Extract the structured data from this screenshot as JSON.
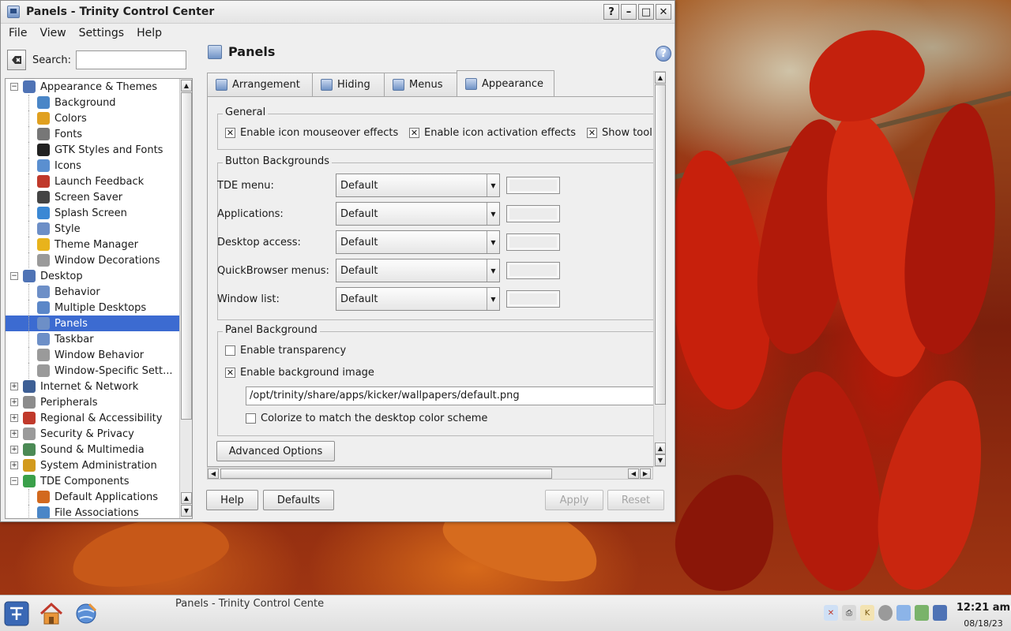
{
  "window": {
    "title": "Panels - Trinity Control Center",
    "buttons": {
      "help": "?",
      "minimize": "–",
      "maximize": "□",
      "close": "✕"
    }
  },
  "menubar": [
    "File",
    "View",
    "Settings",
    "Help"
  ],
  "search": {
    "label": "Search:",
    "value": "",
    "placeholder": ""
  },
  "tree": [
    {
      "label": "Appearance & Themes",
      "type": "parent",
      "expanded": true,
      "icon": "appearance-icon",
      "color": "#4f73b5"
    },
    {
      "label": "Background",
      "type": "child",
      "icon": "background-icon",
      "color": "#4a86c7"
    },
    {
      "label": "Colors",
      "type": "child",
      "icon": "colors-icon",
      "color": "#e0a020"
    },
    {
      "label": "Fonts",
      "type": "child",
      "icon": "fonts-icon",
      "color": "#777777"
    },
    {
      "label": "GTK Styles and Fonts",
      "type": "child",
      "icon": "gtk-icon",
      "color": "#222222"
    },
    {
      "label": "Icons",
      "type": "child",
      "icon": "icons-icon",
      "color": "#5a8fd0"
    },
    {
      "label": "Launch Feedback",
      "type": "child",
      "icon": "launch-feedback-icon",
      "color": "#c0392b"
    },
    {
      "label": "Screen Saver",
      "type": "child",
      "icon": "screensaver-icon",
      "color": "#444444"
    },
    {
      "label": "Splash Screen",
      "type": "child",
      "icon": "splash-icon",
      "color": "#3b88d4"
    },
    {
      "label": "Style",
      "type": "child",
      "icon": "style-icon",
      "color": "#6d8fc7"
    },
    {
      "label": "Theme Manager",
      "type": "child",
      "icon": "theme-manager-icon",
      "color": "#e8b31c"
    },
    {
      "label": "Window Decorations",
      "type": "child",
      "icon": "window-decorations-icon",
      "color": "#9a9a9a"
    },
    {
      "label": "Desktop",
      "type": "parent",
      "expanded": true,
      "icon": "desktop-icon",
      "color": "#4f73b5"
    },
    {
      "label": "Behavior",
      "type": "child",
      "icon": "behavior-icon",
      "color": "#6d8fc7"
    },
    {
      "label": "Multiple Desktops",
      "type": "child",
      "icon": "multiple-desktops-icon",
      "color": "#5b87c8"
    },
    {
      "label": "Panels",
      "type": "child",
      "selected": true,
      "icon": "panels-icon",
      "color": "#6d8fc7"
    },
    {
      "label": "Taskbar",
      "type": "child",
      "icon": "taskbar-icon",
      "color": "#6d8fc7"
    },
    {
      "label": "Window Behavior",
      "type": "child",
      "icon": "window-behavior-icon",
      "color": "#9a9a9a"
    },
    {
      "label": "Window-Specific Sett...",
      "type": "child",
      "icon": "window-specific-icon",
      "color": "#9a9a9a"
    },
    {
      "label": "Internet & Network",
      "type": "parent",
      "expanded": false,
      "icon": "internet-icon",
      "color": "#3d5f95"
    },
    {
      "label": "Peripherals",
      "type": "parent",
      "expanded": false,
      "icon": "peripherals-icon",
      "color": "#8c8c8c"
    },
    {
      "label": "Regional & Accessibility",
      "type": "parent",
      "expanded": false,
      "icon": "regional-icon",
      "color": "#c0392b"
    },
    {
      "label": "Security & Privacy",
      "type": "parent",
      "expanded": false,
      "icon": "security-icon",
      "color": "#9a9a9a"
    },
    {
      "label": "Sound & Multimedia",
      "type": "parent",
      "expanded": false,
      "icon": "sound-icon",
      "color": "#4b8a55"
    },
    {
      "label": "System Administration",
      "type": "parent",
      "expanded": false,
      "icon": "system-admin-icon",
      "color": "#d29a1c"
    },
    {
      "label": "TDE Components",
      "type": "parent",
      "expanded": true,
      "icon": "tde-components-icon",
      "color": "#3aa04a"
    },
    {
      "label": "Default Applications",
      "type": "child",
      "icon": "default-apps-icon",
      "color": "#d2691e"
    },
    {
      "label": "File Associations",
      "type": "child",
      "icon": "file-associations-icon",
      "color": "#4a86c7"
    }
  ],
  "page": {
    "title": "Panels"
  },
  "tabs": [
    "Arrangement",
    "Hiding",
    "Menus",
    "Appearance"
  ],
  "general": {
    "title": "General",
    "checks": [
      {
        "label": "Enable icon mouseover effects",
        "checked": true
      },
      {
        "label": "Enable icon activation effects",
        "checked": true
      },
      {
        "label": "Show tool",
        "checked": true
      }
    ]
  },
  "button_backgrounds": {
    "title": "Button Backgrounds",
    "rows": [
      {
        "label": "TDE menu:",
        "value": "Default"
      },
      {
        "label": "Applications:",
        "value": "Default"
      },
      {
        "label": "Desktop access:",
        "value": "Default"
      },
      {
        "label": "QuickBrowser menus:",
        "value": "Default"
      },
      {
        "label": "Window list:",
        "value": "Default"
      }
    ]
  },
  "panel_background": {
    "title": "Panel Background",
    "transparency": {
      "label": "Enable transparency",
      "checked": false
    },
    "background_image": {
      "label": "Enable background image",
      "checked": true
    },
    "image_path": "/opt/trinity/share/apps/kicker/wallpapers/default.png",
    "colorize": {
      "label": "Colorize to match the desktop color scheme",
      "checked": false
    }
  },
  "advanced_options": "Advanced Options",
  "footer": {
    "help": "Help",
    "defaults": "Defaults",
    "apply": "Apply",
    "reset": "Reset"
  },
  "taskbar": {
    "task_title": "Panels - Trinity Control Cente",
    "time": "12:21 am",
    "date": "08/18/23"
  }
}
